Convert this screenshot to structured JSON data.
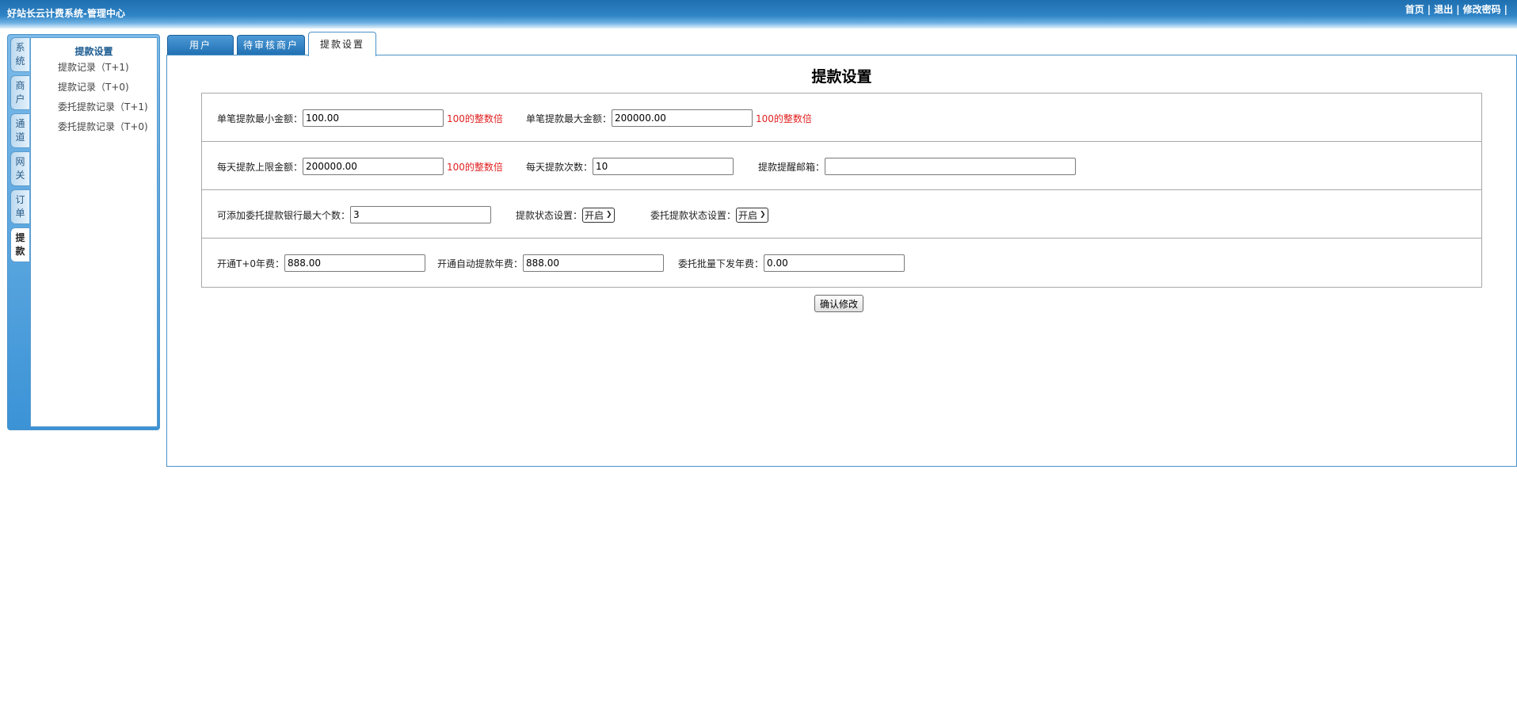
{
  "header": {
    "title": "好站长云计费系统-管理中心",
    "links": [
      "首页",
      "退出",
      "修改密码"
    ],
    "separator": "|"
  },
  "sidebar": {
    "vtabs": [
      "系统",
      "商户",
      "通道",
      "网关",
      "订单",
      "提款"
    ],
    "active_vtab": "提款",
    "menu_heading": "提款设置",
    "menu_items": [
      "提款记录（T+1)",
      "提款记录（T+0)",
      "委托提款记录（T+1)",
      "委托提款记录（T+0)"
    ]
  },
  "tabs": [
    "用户",
    "待审核商户",
    "提款设置"
  ],
  "active_tab": "提款设置",
  "page_title": "提款设置",
  "form": {
    "min_single_label": "单笔提款最小金额：",
    "min_single_value": "100.00",
    "min_single_hint": "100的整数倍",
    "max_single_label": "单笔提款最大金额：",
    "max_single_value": "200000.00",
    "max_single_hint": "100的整数倍",
    "daily_limit_label": "每天提款上限金额：",
    "daily_limit_value": "200000.00",
    "daily_limit_hint": "100的整数倍",
    "daily_count_label": "每天提款次数：",
    "daily_count_value": "10",
    "notify_email_label": "提款提醒邮箱：",
    "notify_email_value": "",
    "max_banks_label": "可添加委托提款银行最大个数：",
    "max_banks_value": "3",
    "withdraw_status_label": "提款状态设置：",
    "withdraw_status_value": "开启",
    "entrust_status_label": "委托提款状态设置：",
    "entrust_status_value": "开启",
    "t0_fee_label": "开通T+0年费：",
    "t0_fee_value": "888.00",
    "auto_fee_label": "开通自动提款年费：",
    "auto_fee_value": "888.00",
    "batch_fee_label": "委托批量下发年费：",
    "batch_fee_value": "0.00"
  },
  "confirm_label": "确认修改",
  "colors": {
    "header_blue": "#2f84c6",
    "hint_red": "#e02020",
    "border_blue": "#4b92c9"
  }
}
